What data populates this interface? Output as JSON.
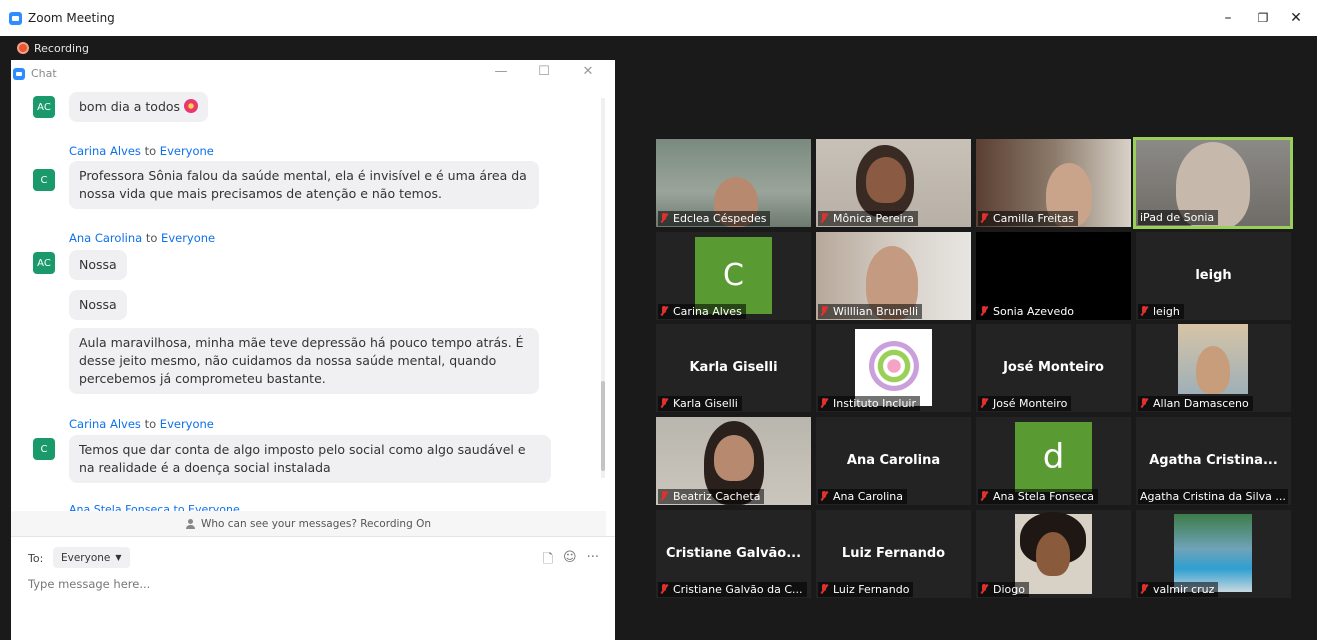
{
  "window": {
    "title": "Zoom Meeting",
    "minimize": "–",
    "restore": "❐",
    "close": "✕"
  },
  "recording": {
    "label": "Recording"
  },
  "chat": {
    "title": "Chat",
    "controls": {
      "minimize": "—",
      "maximize": "☐",
      "close": "✕"
    },
    "messages": [
      {
        "avatar": "AC",
        "sender": "",
        "to": "",
        "audience": "",
        "texts": [
          "bom dia a todos"
        ]
      },
      {
        "avatar": "C",
        "sender": "Carina Alves",
        "to": "to",
        "audience": "Everyone",
        "texts": [
          "Professora Sônia falou da saúde mental, ela é invisível e é uma área da nossa vida que mais precisamos de atenção e não temos."
        ]
      },
      {
        "avatar": "AC",
        "sender": "Ana Carolina",
        "to": "to",
        "audience": "Everyone",
        "texts": [
          "Nossa",
          "Nossa",
          "Aula maravilhosa, minha mãe teve depressão há pouco tempo atrás.  É desse jeito mesmo, não cuidamos da nossa saúde mental, quando percebemos já comprometeu bastante."
        ]
      },
      {
        "avatar": "C",
        "sender": "Carina Alves",
        "to": "to",
        "audience": "Everyone",
        "texts": [
          "Temos que dar conta de algo imposto pelo social como algo saudável e na realidade é a doença social instalada"
        ]
      }
    ],
    "cutoff_sender": "Ana Stela Fonseca to Everyone",
    "notice": "Who can see your messages? Recording On",
    "compose": {
      "to_label": "To:",
      "recipient": "Everyone",
      "placeholder": "Type message here...",
      "more": "···"
    }
  },
  "participants": [
    {
      "name": "Edclea Céspedes"
    },
    {
      "name": "Mônica Pereira"
    },
    {
      "name": "Camilla Freitas"
    },
    {
      "name": "iPad de Sonia"
    },
    {
      "name": "Carina Alves",
      "letter": "C"
    },
    {
      "name": "Willlian Brunelli"
    },
    {
      "name": "Sonia Azevedo"
    },
    {
      "name": "leigh",
      "display": "leigh"
    },
    {
      "name": "Karla Giselli",
      "display": "Karla Giselli"
    },
    {
      "name": "Instituto Incluir"
    },
    {
      "name": "José Monteiro",
      "display": "José Monteiro"
    },
    {
      "name": "Allan Damasceno"
    },
    {
      "name": "Beatriz Cacheta"
    },
    {
      "name": "Ana Carolina",
      "display": "Ana Carolina"
    },
    {
      "name": "Ana Stela Fonseca",
      "letter": "d"
    },
    {
      "name": "Agatha Cristina da Silva ...",
      "display": "Agatha  Cristina..."
    },
    {
      "name": "Cristiane Galvão da C...",
      "display": "Cristiane  Galvão..."
    },
    {
      "name": "Luiz Fernando",
      "display": "Luiz Fernando"
    },
    {
      "name": "Diogo"
    },
    {
      "name": "valmir cruz"
    }
  ],
  "colors": {
    "accent": "#0e71eb",
    "active_speaker": "#9ad05a",
    "muted": "#e0312f",
    "letter_avatar": "#5a9a32"
  }
}
